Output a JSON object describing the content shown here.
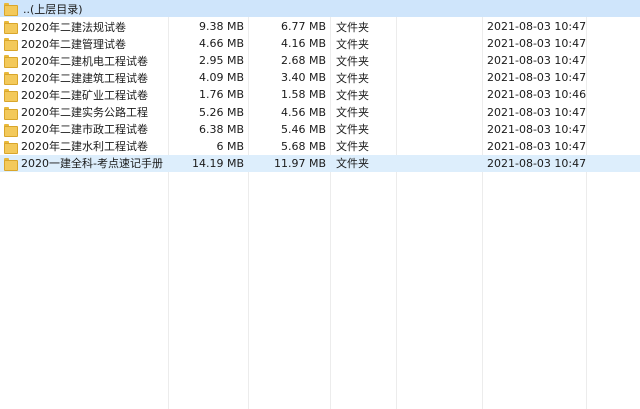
{
  "parent_row": {
    "label": "..(上层目录)"
  },
  "rows": [
    {
      "name": "2020年二建法规试卷",
      "size": "9.38 MB",
      "packed": "6.77 MB",
      "type": "文件夹",
      "date": "2021-08-03 10:47:..."
    },
    {
      "name": "2020年二建管理试卷",
      "size": "4.66 MB",
      "packed": "4.16 MB",
      "type": "文件夹",
      "date": "2021-08-03 10:47:..."
    },
    {
      "name": "2020年二建机电工程试卷",
      "size": "2.95 MB",
      "packed": "2.68 MB",
      "type": "文件夹",
      "date": "2021-08-03 10:47:..."
    },
    {
      "name": "2020年二建建筑工程试卷",
      "size": "4.09 MB",
      "packed": "3.40 MB",
      "type": "文件夹",
      "date": "2021-08-03 10:47:..."
    },
    {
      "name": "2020年二建矿业工程试卷",
      "size": "1.76 MB",
      "packed": "1.58 MB",
      "type": "文件夹",
      "date": "2021-08-03 10:46:..."
    },
    {
      "name": "2020年二建实务公路工程",
      "size": "5.26 MB",
      "packed": "4.56 MB",
      "type": "文件夹",
      "date": "2021-08-03 10:47:..."
    },
    {
      "name": "2020年二建市政工程试卷",
      "size": "6.38 MB",
      "packed": "5.46 MB",
      "type": "文件夹",
      "date": "2021-08-03 10:47:..."
    },
    {
      "name": "2020年二建水利工程试卷",
      "size": "6 MB",
      "packed": "5.68 MB",
      "type": "文件夹",
      "date": "2021-08-03 10:47:..."
    },
    {
      "name": "2020一建全科-考点速记手册",
      "size": "14.19 MB",
      "packed": "11.97 MB",
      "type": "文件夹",
      "date": "2021-08-03 10:47:..."
    }
  ],
  "colors": {
    "parent_row_bg": "#cfe5fb",
    "selected_row_bg": "#ddeefc",
    "folder": "#f3c95a"
  }
}
